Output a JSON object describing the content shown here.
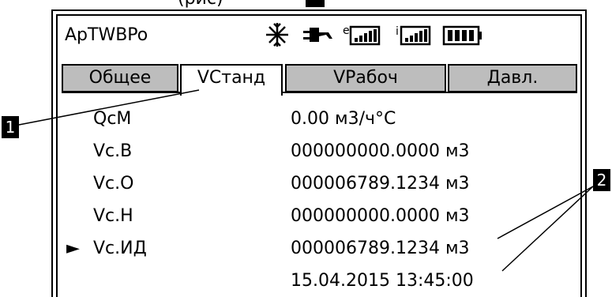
{
  "header_caption": "(рис)",
  "device_title": "ApTWBPo",
  "status_icons": [
    "snowflake-icon",
    "power-plug-icon",
    "e-signal-icon",
    "i-signal-icon",
    "battery-icon"
  ],
  "tabs": [
    {
      "label": "Общее",
      "active": false
    },
    {
      "label": "VСтанд",
      "active": true
    },
    {
      "label": "VРабоч",
      "active": false
    },
    {
      "label": "Давл.",
      "active": false
    }
  ],
  "rows": [
    {
      "label": "QсM",
      "value": "0.00 м3/ч°С",
      "selected": false
    },
    {
      "label": "Vс.В",
      "value": "000000000.0000 м3",
      "selected": false
    },
    {
      "label": "Vс.О",
      "value": "000006789.1234 м3",
      "selected": false
    },
    {
      "label": "Vс.Н",
      "value": "000000000.0000 м3",
      "selected": false
    },
    {
      "label": "Vс.ИД",
      "value": "000006789.1234 м3",
      "selected": true
    },
    {
      "label": "",
      "value": "15.04.2015 13:45:00",
      "selected": false
    }
  ],
  "selection_marker": "►",
  "callouts": [
    "1",
    "2"
  ]
}
